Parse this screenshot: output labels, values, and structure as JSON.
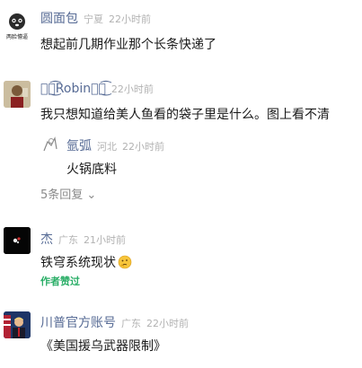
{
  "comments": [
    {
      "name": "圆面包",
      "location": "宁夏",
      "time": "22小时前",
      "text": "想起前几期作业那个长条快递了",
      "avatar_caption": "两脸懵逼"
    },
    {
      "name": "ৡৢ͜͡Robinৡৢ͜͡",
      "time": "22小时前",
      "text": "我只想知道给美人鱼看的袋子里是什么。图上看不清",
      "reply": {
        "name": "氩弧",
        "location": "河北",
        "time": "22小时前",
        "text": "火锅底料"
      },
      "replies_label": "5条回复 ⌄"
    },
    {
      "name": "杰",
      "location": "广东",
      "time": "21小时前",
      "text": "铁穹系统现状",
      "emoji": "thinking-face-icon",
      "badge": "作者赞过"
    },
    {
      "name": "川普官方账号",
      "location": "广东",
      "time": "22小时前",
      "text": "《美国援乌武器限制》"
    }
  ],
  "colors": {
    "name": "#576b95",
    "meta": "#b2b2b2",
    "liked": "#2aae67",
    "text": "#191919"
  }
}
